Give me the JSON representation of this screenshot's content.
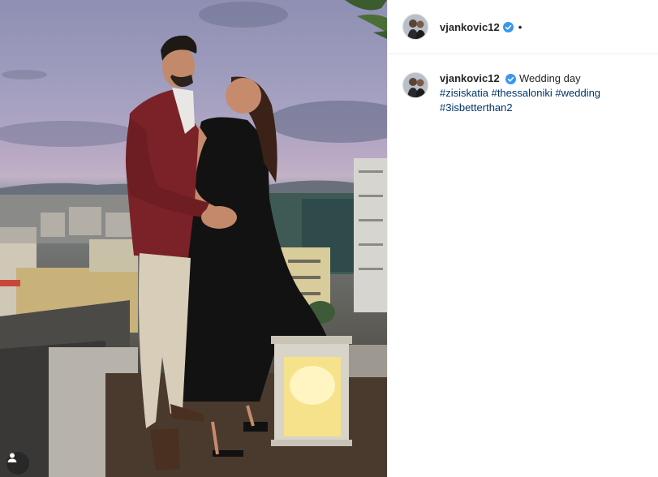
{
  "post": {
    "photo_alt": "",
    "user_icon": "user-tag-icon"
  },
  "header": {
    "username": "vjankovic12",
    "verified_icon": "verified-badge-icon",
    "separator": "•"
  },
  "comment": {
    "username": "vjankovic12",
    "caption": "Wedding day",
    "hashtags": [
      "#zisiskatia",
      "#thessaloniki",
      "#wedding",
      "#3isbetterthan2"
    ]
  },
  "colors": {
    "link": "#003569",
    "verified": "#3897f0",
    "text": "#262626",
    "border": "#efefef"
  }
}
